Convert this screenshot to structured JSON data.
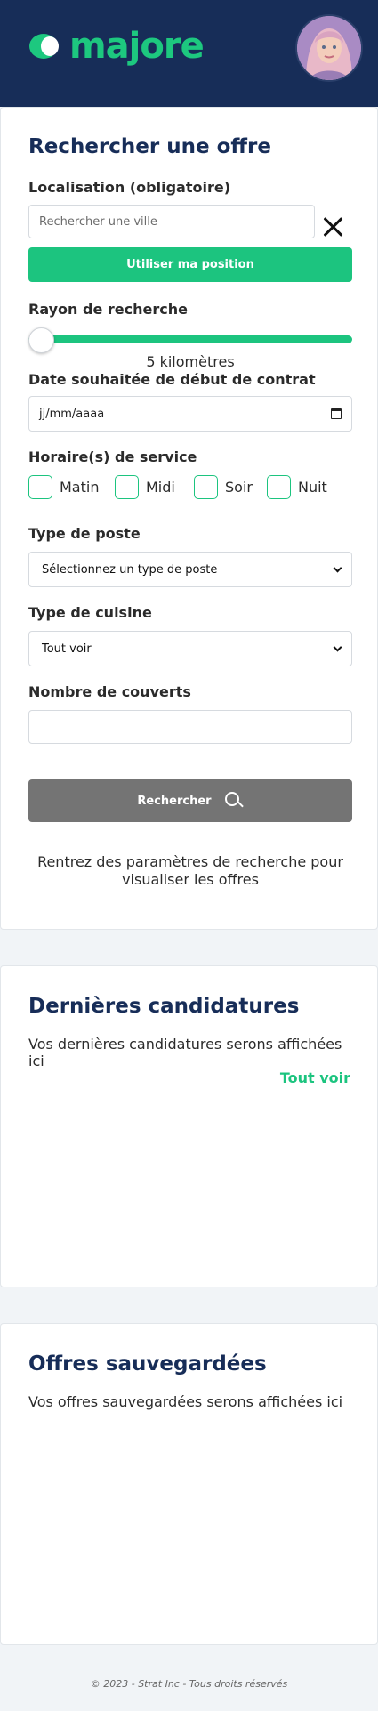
{
  "header": {
    "logo_text": "majore",
    "brand_color": "#1dc87f",
    "header_bg": "#172d58",
    "avatar_icon": "user-avatar"
  },
  "search": {
    "title": "Rechercher une offre",
    "location_label": "Localisation (obligatoire)",
    "location_placeholder": "Rechercher une ville",
    "location_value": "",
    "clear_icon": "close-icon",
    "use_position_label": "Utiliser ma position",
    "radius_label": "Rayon de recherche",
    "radius_value_text": "5 kilomètres",
    "radius_slider_fraction": 0,
    "start_date_label": "Date souhaitée de début de contrat",
    "start_date_placeholder": "jj/mm/aaaa",
    "start_date_icon": "calendar-icon",
    "schedule_label": "Horaire(s) de service",
    "schedules": [
      {
        "label": "Matin",
        "checked": false
      },
      {
        "label": "Midi",
        "checked": false
      },
      {
        "label": "Soir",
        "checked": false
      },
      {
        "label": "Nuit",
        "checked": false
      }
    ],
    "post_type_label": "Type de poste",
    "post_type_selected": "Sélectionnez un type de poste",
    "cuisine_label": "Type de cuisine",
    "cuisine_selected": "Tout voir",
    "covers_label": "Nombre de couverts",
    "covers_value": "",
    "search_button_label": "Rechercher",
    "search_icon": "search-icon",
    "hint_text": "Rentrez des paramètres de recherche pour visualiser les offres"
  },
  "candidatures": {
    "title": "Dernières candidatures",
    "empty_text": "Vos dernières candidatures serons affichées ici",
    "see_all_label": "Tout voir"
  },
  "saved": {
    "title": "Offres sauvegardées",
    "empty_text": "Vos offres sauvegardées serons affichées ici"
  },
  "footer": {
    "text": "© 2023 - Strat Inc - Tous droits réservés"
  }
}
